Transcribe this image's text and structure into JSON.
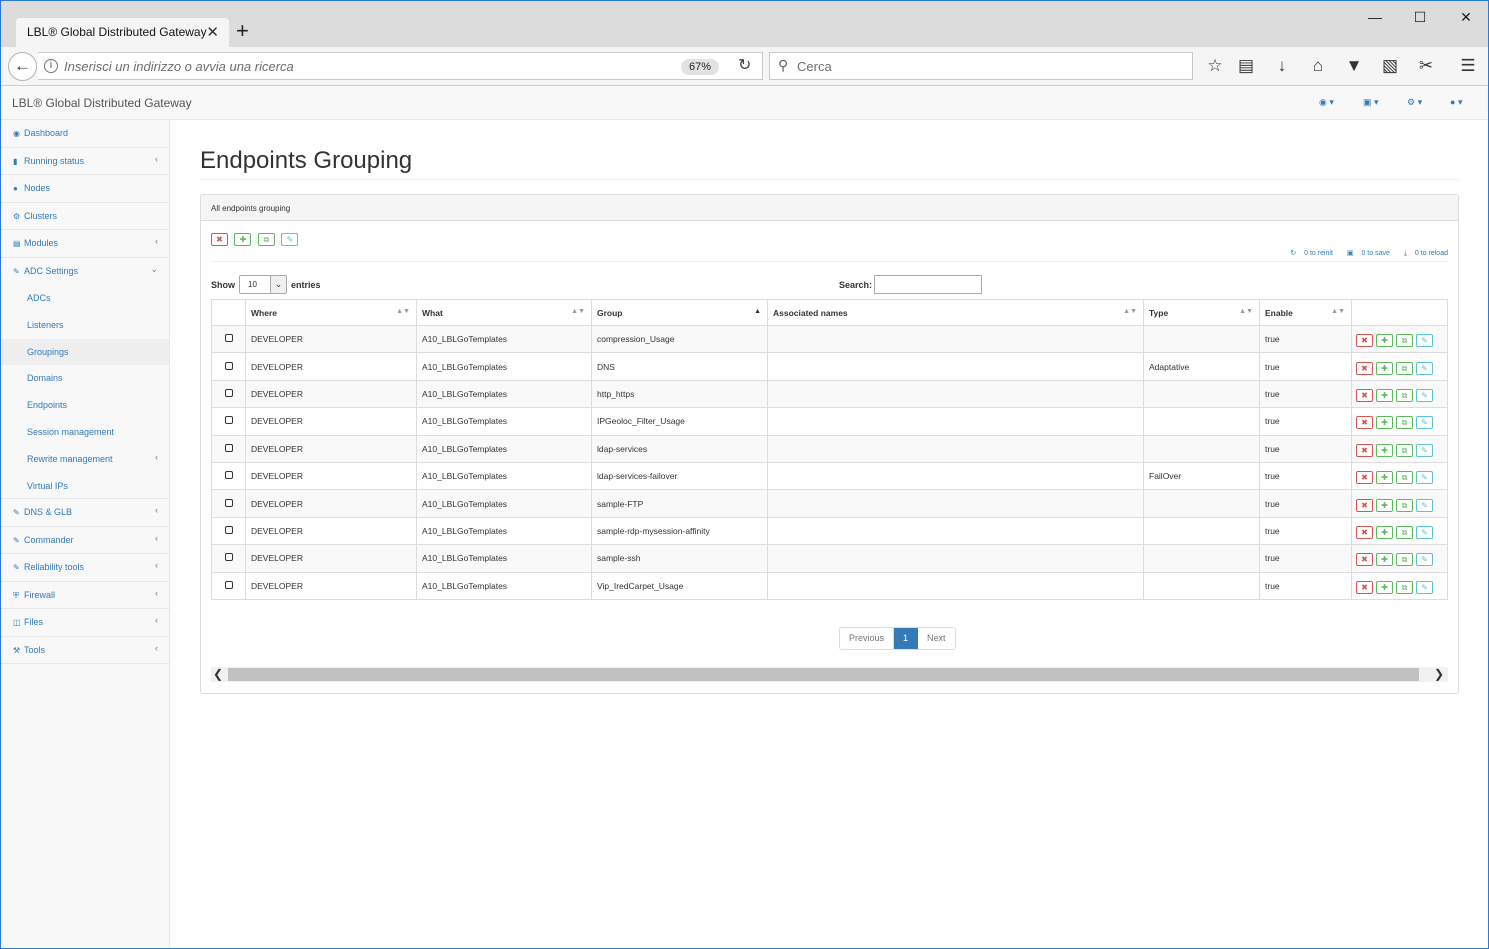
{
  "browser": {
    "tab_title": "LBL® Global Distributed Gateway",
    "tab_close": "✕",
    "new_tab": "+",
    "url_placeholder": "Inserisci un indirizzo o avvia una ricerca",
    "zoom": "67%",
    "search_placeholder": "Cerca",
    "window_controls": {
      "minimize": "—",
      "maximize": "☐",
      "close": "✕"
    }
  },
  "app": {
    "title": "LBL® Global Distributed Gateway",
    "header_menus": [
      "dashboard-menu",
      "save-menu",
      "settings-menu",
      "user-menu"
    ]
  },
  "sidebar": {
    "items": [
      {
        "label": "Dashboard",
        "icon": "dashboard-icon",
        "has_children": false
      },
      {
        "label": "Running status",
        "icon": "bar-chart-icon",
        "has_children": true
      },
      {
        "label": "Nodes",
        "icon": "cube-icon",
        "has_children": false
      },
      {
        "label": "Clusters",
        "icon": "cogs-icon",
        "has_children": false
      },
      {
        "label": "Modules",
        "icon": "list-icon",
        "has_children": true
      },
      {
        "label": "ADC Settings",
        "icon": "edit-icon",
        "has_children": true,
        "expanded": true
      }
    ],
    "sub_items": [
      {
        "label": "ADCs",
        "active": false
      },
      {
        "label": "Listeners",
        "active": false
      },
      {
        "label": "Groupings",
        "active": true
      },
      {
        "label": "Domains",
        "active": false
      },
      {
        "label": "Endpoints",
        "active": false
      },
      {
        "label": "Session management",
        "active": false
      },
      {
        "label": "Rewrite management",
        "active": false,
        "has_children": true
      },
      {
        "label": "Virtual IPs",
        "active": false
      }
    ],
    "items_after": [
      {
        "label": "DNS & GLB",
        "icon": "edit-icon",
        "has_children": true
      },
      {
        "label": "Commander",
        "icon": "edit-icon",
        "has_children": true
      },
      {
        "label": "Reliability tools",
        "icon": "edit-icon",
        "has_children": true
      },
      {
        "label": "Firewall",
        "icon": "shield-icon",
        "has_children": true
      },
      {
        "label": "Files",
        "icon": "files-icon",
        "has_children": true
      },
      {
        "label": "Tools",
        "icon": "wrench-icon",
        "has_children": true
      }
    ]
  },
  "main": {
    "title": "Endpoints Grouping",
    "panel_title": "All endpoints grouping",
    "status": {
      "reinit": "0 to reinit",
      "save": "0 to save",
      "reload": "0 to reload"
    },
    "length": {
      "show_label": "Show",
      "value": "10",
      "entries_label": "entries"
    },
    "search_label": "Search:",
    "columns": [
      "",
      "Where",
      "What",
      "Group",
      "Associated names",
      "Type",
      "Enable",
      ""
    ],
    "rows": [
      {
        "where": "DEVELOPER",
        "what": "A10_LBLGoTemplates",
        "group": "compression_Usage",
        "names": "",
        "type": "",
        "enable": "true"
      },
      {
        "where": "DEVELOPER",
        "what": "A10_LBLGoTemplates",
        "group": "DNS",
        "names": "",
        "type": "Adaptative",
        "enable": "true"
      },
      {
        "where": "DEVELOPER",
        "what": "A10_LBLGoTemplates",
        "group": "http_https",
        "names": "",
        "type": "",
        "enable": "true"
      },
      {
        "where": "DEVELOPER",
        "what": "A10_LBLGoTemplates",
        "group": "IPGeoloc_Filter_Usage",
        "names": "",
        "type": "",
        "enable": "true"
      },
      {
        "where": "DEVELOPER",
        "what": "A10_LBLGoTemplates",
        "group": "ldap-services",
        "names": "",
        "type": "",
        "enable": "true"
      },
      {
        "where": "DEVELOPER",
        "what": "A10_LBLGoTemplates",
        "group": "ldap-services-failover",
        "names": "",
        "type": "FailOver",
        "enable": "true"
      },
      {
        "where": "DEVELOPER",
        "what": "A10_LBLGoTemplates",
        "group": "sample-FTP",
        "names": "",
        "type": "",
        "enable": "true"
      },
      {
        "where": "DEVELOPER",
        "what": "A10_LBLGoTemplates",
        "group": "sample-rdp-mysession-affinity",
        "names": "",
        "type": "",
        "enable": "true"
      },
      {
        "where": "DEVELOPER",
        "what": "A10_LBLGoTemplates",
        "group": "sample-ssh",
        "names": "",
        "type": "",
        "enable": "true"
      },
      {
        "where": "DEVELOPER",
        "what": "A10_LBLGoTemplates",
        "group": "Vip_IredCarpet_Usage",
        "names": "",
        "type": "",
        "enable": "true"
      }
    ],
    "pager": {
      "previous": "Previous",
      "current": "1",
      "next": "Next"
    },
    "colors": {
      "link": "#337ab7",
      "danger": "#d9534f",
      "success": "#5cb85c",
      "info": "#5bc0de"
    }
  }
}
